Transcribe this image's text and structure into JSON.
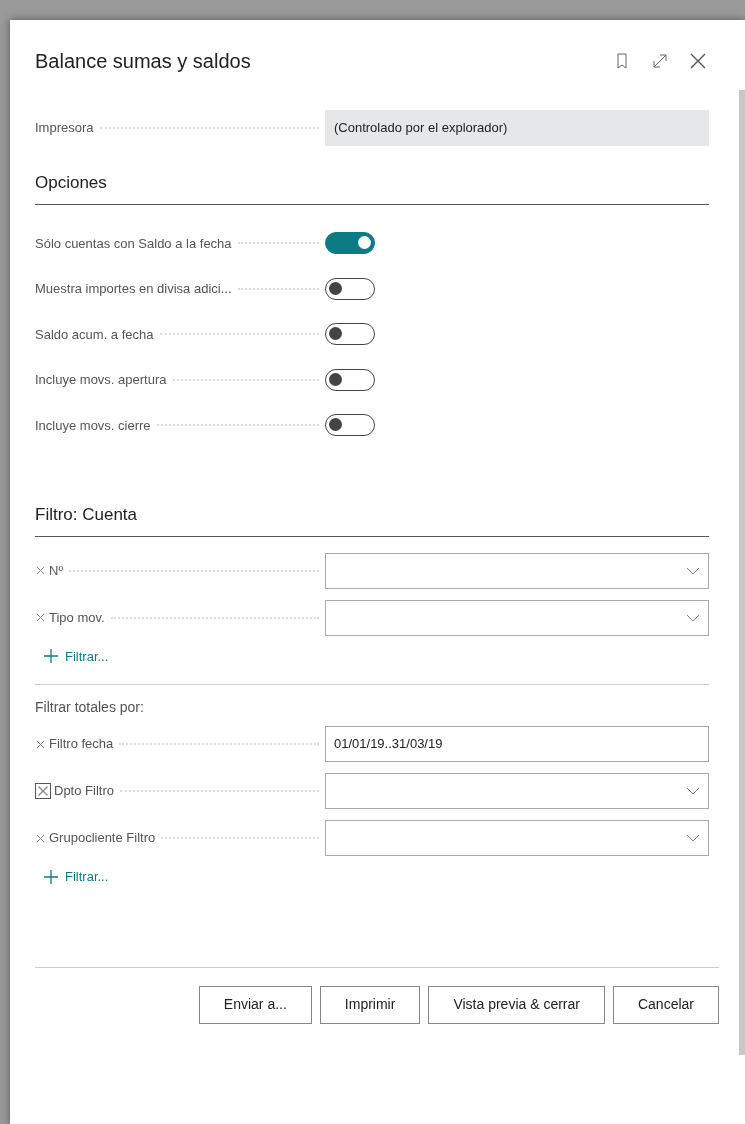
{
  "window": {
    "title": "Balance sumas y saldos"
  },
  "printer": {
    "label": "Impresora",
    "value": "(Controlado por el explorador)"
  },
  "options": {
    "heading": "Opciones",
    "toggles": [
      {
        "label": "Sólo cuentas con Saldo a la fecha",
        "on": true
      },
      {
        "label": "Muestra importes en divisa adici...",
        "on": false
      },
      {
        "label": "Saldo acum. a fecha",
        "on": false
      },
      {
        "label": "Incluye movs. apertura",
        "on": false
      },
      {
        "label": "Incluye movs. cierre",
        "on": false
      }
    ]
  },
  "account_filter": {
    "heading": "Filtro: Cuenta",
    "fields": [
      {
        "label": "Nº",
        "kind": "dropdown",
        "focused": false
      },
      {
        "label": "Tipo mov.",
        "kind": "dropdown",
        "focused": false
      }
    ],
    "add_filter": "Filtrar..."
  },
  "totals_filter": {
    "heading": "Filtrar totales por:",
    "fields": [
      {
        "label": "Filtro fecha",
        "kind": "text",
        "value": "01/01/19..31/03/19",
        "focused": false
      },
      {
        "label": "Dpto Filtro",
        "kind": "dropdown",
        "focused": true
      },
      {
        "label": "Grupocliente Filtro",
        "kind": "dropdown",
        "focused": false
      }
    ],
    "add_filter": "Filtrar..."
  },
  "buttons": [
    "Enviar a...",
    "Imprimir",
    "Vista previa & cerrar",
    "Cancelar"
  ]
}
